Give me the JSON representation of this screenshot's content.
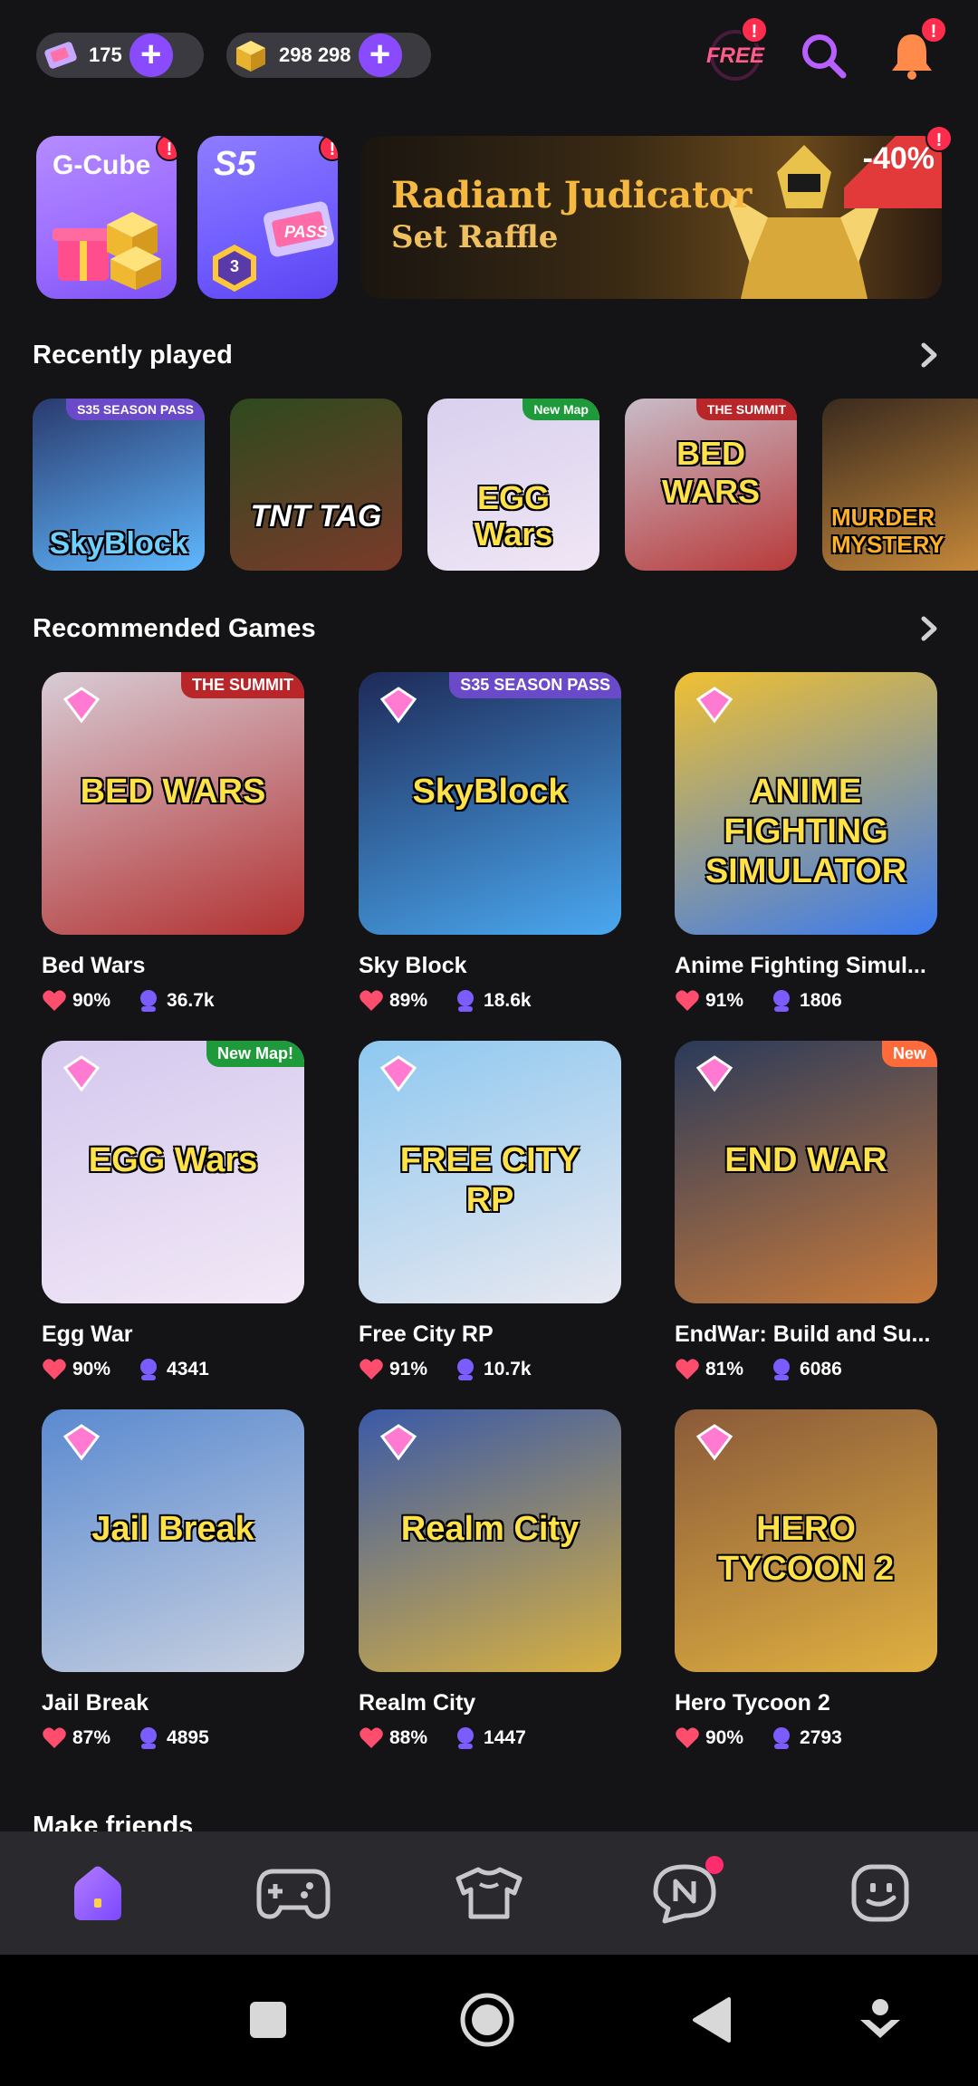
{
  "topbar": {
    "tickets": "175",
    "cubes": "298 298",
    "free_label": "FREE",
    "badge": "!"
  },
  "promos": {
    "gcube_title": "G-Cube",
    "s5_title": "S5",
    "s5_level": "3",
    "s5_pass": "PASS",
    "raffle_line1": "Radiant Judicator",
    "raffle_line2": "Set Raffle",
    "raffle_discount": "-40%"
  },
  "sections": {
    "recent_title": "Recently played",
    "recommended_title": "Recommended Games",
    "make_friends_title": "Make friends"
  },
  "recent": [
    {
      "title": "SkyBlock",
      "tag": "S35 SEASON PASS",
      "color_a": "#2a3a6e",
      "color_b": "#5fb8ff"
    },
    {
      "title": "TNT TAG",
      "tag": "",
      "color_a": "#2e4a1e",
      "color_b": "#7a3a2a"
    },
    {
      "title": "EGG Wars",
      "tag": "New Map",
      "color_a": "#d8d0ee",
      "color_b": "#f0e6f5"
    },
    {
      "title": "BED WARS",
      "tag": "THE SUMMIT",
      "color_a": "#c8bcc8",
      "color_b": "#b83a3a"
    },
    {
      "title": "MURDER MYSTERY",
      "tag": "",
      "color_a": "#3a2a1e",
      "color_b": "#c88a3a"
    }
  ],
  "games": [
    {
      "name": "Bed Wars",
      "rating": "90%",
      "players": "36.7k",
      "thumb_text": "BED WARS",
      "tag": "THE SUMMIT",
      "ca": "#d8ccd6",
      "cb": "#b23232"
    },
    {
      "name": "Sky Block",
      "rating": "89%",
      "players": "18.6k",
      "thumb_text": "SkyBlock",
      "tag": "S35 SEASON PASS",
      "ca": "#1e2a58",
      "cb": "#4aa8f0"
    },
    {
      "name": "Anime Fighting Simul...",
      "rating": "91%",
      "players": "1806",
      "thumb_text": "ANIME FIGHTING SIMULATOR",
      "tag": "",
      "ca": "#f0c030",
      "cb": "#3a7af0"
    },
    {
      "name": "Egg War",
      "rating": "90%",
      "players": "4341",
      "thumb_text": "EGG Wars",
      "tag": "New Map!",
      "ca": "#d4c8ee",
      "cb": "#f2e8f6"
    },
    {
      "name": "Free City RP",
      "rating": "91%",
      "players": "10.7k",
      "thumb_text": "FREE CITY RP",
      "tag": "",
      "ca": "#8ec8f0",
      "cb": "#e8e8f0"
    },
    {
      "name": "EndWar: Build and Su...",
      "rating": "81%",
      "players": "6086",
      "thumb_text": "END WAR",
      "tag": "New",
      "ca": "#2a3a5a",
      "cb": "#c87a3a"
    },
    {
      "name": "Jail Break",
      "rating": "87%",
      "players": "4895",
      "thumb_text": "Jail Break",
      "tag": "",
      "ca": "#5a8ad0",
      "cb": "#c8d0e0"
    },
    {
      "name": "Realm City",
      "rating": "88%",
      "players": "1447",
      "thumb_text": "Realm City",
      "tag": "",
      "ca": "#3a5aa8",
      "cb": "#d8b040"
    },
    {
      "name": "Hero Tycoon 2",
      "rating": "90%",
      "players": "2793",
      "thumb_text": "HERO TYCOON 2",
      "tag": "",
      "ca": "#8a5a3a",
      "cb": "#e0b040"
    }
  ],
  "colors": {
    "accent": "#8a4bff",
    "badge": "#ff2d4d",
    "heart": "#ff4d6d",
    "players": "#7b5cff"
  },
  "icons": {
    "nav": [
      "home-icon",
      "gamepad-icon",
      "shirt-icon",
      "chat-icon",
      "face-icon"
    ],
    "system": [
      "square-icon",
      "circle-icon",
      "back-icon",
      "download-icon"
    ]
  }
}
